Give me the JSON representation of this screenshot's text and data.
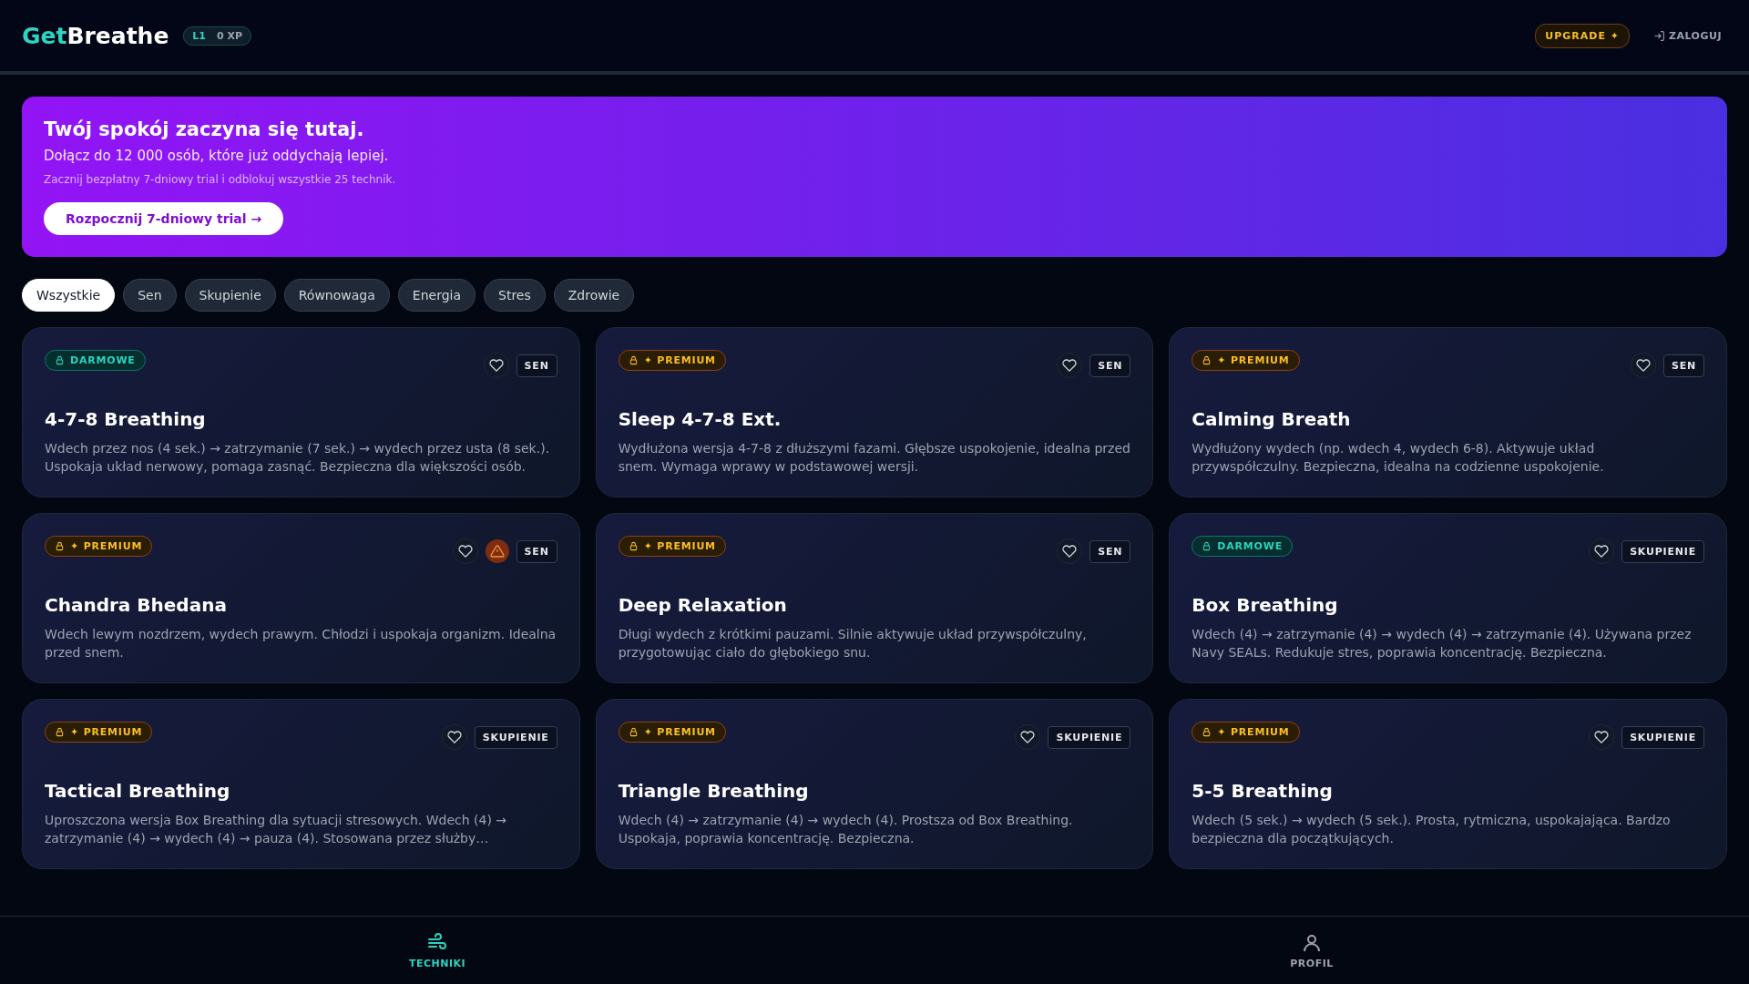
{
  "header": {
    "logo_accent": "Get",
    "logo_rest": "Breathe",
    "level": "L1",
    "xp": "0 XP",
    "upgrade": "UPGRADE ✦",
    "login": "ZALOGUJ"
  },
  "banner": {
    "title": "Twój spokój zaczyna się tutaj.",
    "subtitle": "Dołącz do 12 000 osób, które już oddychają lepiej.",
    "note": "Zacznij bezpłatny 7-dniowy trial i odblokuj wszystkie 25 technik.",
    "cta": "Rozpocznij 7-dniowy trial →"
  },
  "filters": [
    {
      "label": "Wszystkie",
      "selected": true
    },
    {
      "label": "Sen",
      "selected": false
    },
    {
      "label": "Skupienie",
      "selected": false
    },
    {
      "label": "Równowaga",
      "selected": false
    },
    {
      "label": "Energia",
      "selected": false
    },
    {
      "label": "Stres",
      "selected": false
    },
    {
      "label": "Zdrowie",
      "selected": false
    }
  ],
  "cards": [
    {
      "badge": {
        "kind": "free",
        "label": "DARMOWE"
      },
      "warning": false,
      "tag": "SEN",
      "title": "4-7-8 Breathing",
      "description": "Wdech przez nos (4 sek.) → zatrzymanie (7 sek.) → wydech przez usta (8 sek.). Uspokaja układ nerwowy, pomaga zasnąć. Bezpieczna dla większości osób."
    },
    {
      "badge": {
        "kind": "premium",
        "label": "✦ PREMIUM"
      },
      "warning": false,
      "tag": "SEN",
      "title": "Sleep 4-7-8 Ext.",
      "description": "Wydłużona wersja 4-7-8 z dłuższymi fazami. Głębsze uspokojenie, idealna przed snem. Wymaga wprawy w podstawowej wersji."
    },
    {
      "badge": {
        "kind": "premium",
        "label": "✦ PREMIUM"
      },
      "warning": false,
      "tag": "SEN",
      "title": "Calming Breath",
      "description": "Wydłużony wydech (np. wdech 4, wydech 6-8). Aktywuje układ przywspółczulny. Bezpieczna, idealna na codzienne uspokojenie."
    },
    {
      "badge": {
        "kind": "premium",
        "label": "✦ PREMIUM"
      },
      "warning": true,
      "tag": "SEN",
      "title": "Chandra Bhedana",
      "description": "Wdech lewym nozdrzem, wydech prawym. Chłodzi i uspokaja organizm. Idealna przed snem."
    },
    {
      "badge": {
        "kind": "premium",
        "label": "✦ PREMIUM"
      },
      "warning": false,
      "tag": "SEN",
      "title": "Deep Relaxation",
      "description": "Długi wydech z krótkimi pauzami. Silnie aktywuje układ przywspółczulny, przygotowując ciało do głębokiego snu."
    },
    {
      "badge": {
        "kind": "free",
        "label": "DARMOWE"
      },
      "warning": false,
      "tag": "SKUPIENIE",
      "title": "Box Breathing",
      "description": "Wdech (4) → zatrzymanie (4) → wydech (4) → zatrzymanie (4). Używana przez Navy SEALs. Redukuje stres, poprawia koncentrację. Bezpieczna."
    },
    {
      "badge": {
        "kind": "premium",
        "label": "✦ PREMIUM"
      },
      "warning": false,
      "tag": "SKUPIENIE",
      "title": "Tactical Breathing",
      "description": "Uproszczona wersja Box Breathing dla sytuacji stresowych. Wdech (4) → zatrzymanie (4) → wydech (4) → pauza (4). Stosowana przez służby…"
    },
    {
      "badge": {
        "kind": "premium",
        "label": "✦ PREMIUM"
      },
      "warning": false,
      "tag": "SKUPIENIE",
      "title": "Triangle Breathing",
      "description": "Wdech (4) → zatrzymanie (4) → wydech (4). Prostsza od Box Breathing. Uspokaja, poprawia koncentrację. Bezpieczna."
    },
    {
      "badge": {
        "kind": "premium",
        "label": "✦ PREMIUM"
      },
      "warning": false,
      "tag": "SKUPIENIE",
      "title": "5-5 Breathing",
      "description": "Wdech (5 sek.) → wydech (5 sek.). Prosta, rytmiczna, uspokajająca. Bardzo bezpieczna dla początkujących."
    }
  ],
  "nav": [
    {
      "kind": "techniques",
      "label": "TECHNIKI",
      "selected": true
    },
    {
      "kind": "profile",
      "label": "PROFIL",
      "selected": false
    }
  ]
}
